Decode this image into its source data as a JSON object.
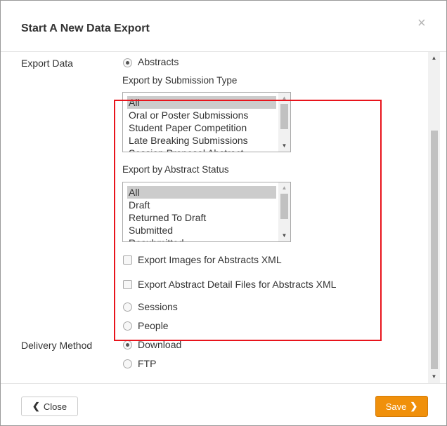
{
  "modal": {
    "title": "Start A New Data Export",
    "close_glyph": "×"
  },
  "form": {
    "export_data_label": "Export Data",
    "delivery_method_label": "Delivery Method",
    "export_options": [
      {
        "label": "Abstracts",
        "checked": true
      },
      {
        "label": "Sessions",
        "checked": false
      },
      {
        "label": "People",
        "checked": false
      }
    ],
    "delivery_options": [
      {
        "label": "Download",
        "checked": true
      },
      {
        "label": "FTP",
        "checked": false
      }
    ],
    "submission_type": {
      "label": "Export by Submission Type",
      "items": [
        "All",
        "Oral or Poster Submissions",
        "Student Paper Competition",
        "Late Breaking Submissions",
        "Session Proposal Abstract"
      ],
      "selected": "All"
    },
    "abstract_status": {
      "label": "Export by Abstract Status",
      "items": [
        "All",
        "Draft",
        "Returned To Draft",
        "Submitted",
        "Resubmitted"
      ],
      "selected": "All"
    },
    "checkboxes": [
      {
        "label": "Export Images for Abstracts XML",
        "checked": false
      },
      {
        "label": "Export Abstract Detail Files for Abstracts XML",
        "checked": false
      }
    ]
  },
  "footer": {
    "close_label": "Close",
    "save_label": "Save"
  },
  "colors": {
    "highlight": "#e8141c",
    "save_button": "#f0900b"
  },
  "icons": {
    "close": "close-icon",
    "back": "chevron-left-icon",
    "forward": "chevron-right-icon"
  }
}
